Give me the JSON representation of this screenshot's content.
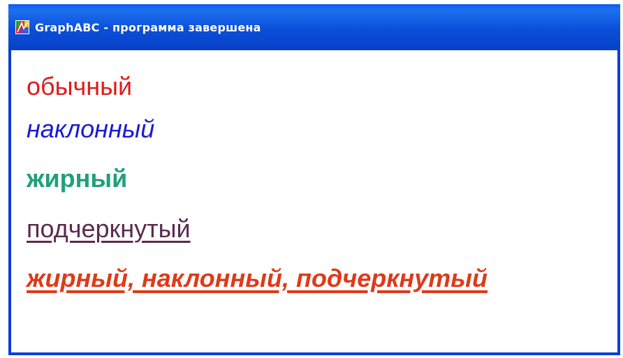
{
  "window": {
    "title": "GraphABC - программа завершена",
    "icon": "graphabc-app-icon"
  },
  "content": {
    "lines": [
      {
        "text": "обычный",
        "style": "normal",
        "color": "#e01b1b"
      },
      {
        "text": "наклонный",
        "style": "italic",
        "color": "#1a1ad6"
      },
      {
        "text": "жирный",
        "style": "bold",
        "color": "#1fa07a"
      },
      {
        "text": "подчеркнутый",
        "style": "underline",
        "color": "#5b2a4e"
      },
      {
        "text": "жирный, наклонный, подчеркнутый",
        "style": "bold italic underline",
        "color": "#de3a1a"
      }
    ]
  },
  "colors": {
    "titlebar": "#0a4fd9",
    "frame": "#0a3fd8",
    "background": "#ffffff"
  }
}
